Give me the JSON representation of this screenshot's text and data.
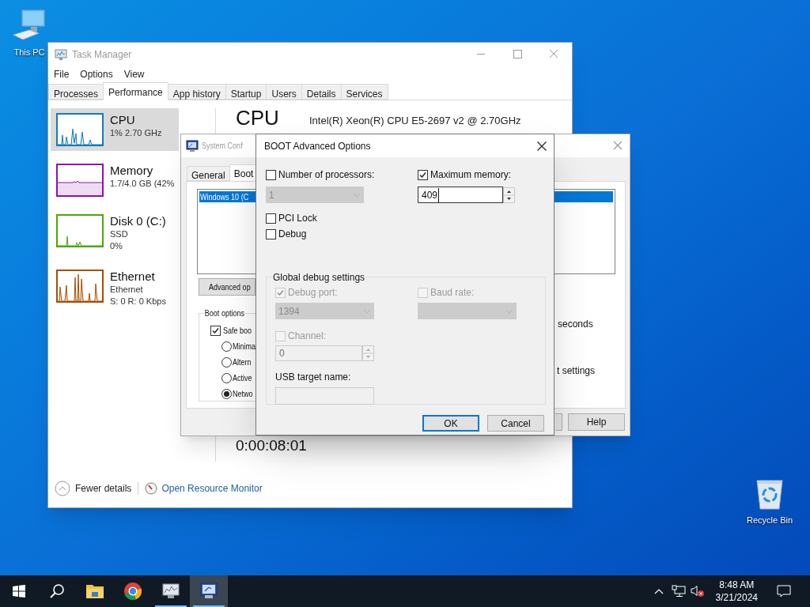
{
  "desktop_icons": [
    {
      "kind": "computer",
      "label": "This PC"
    },
    {
      "kind": "recycle",
      "label": "Recycle Bin"
    }
  ],
  "task_manager": {
    "title": "Task Manager",
    "menu": [
      "File",
      "Options",
      "View"
    ],
    "tabs": [
      {
        "label": "Processes",
        "selected": false
      },
      {
        "label": "Performance",
        "selected": true
      },
      {
        "label": "App history",
        "selected": false
      },
      {
        "label": "Startup",
        "selected": false
      },
      {
        "label": "Users",
        "selected": false
      },
      {
        "label": "Details",
        "selected": false
      },
      {
        "label": "Services",
        "selected": false
      }
    ],
    "resources": [
      {
        "kind": "cpu",
        "name": "CPU",
        "lines": [
          "1% 2.70 GHz"
        ],
        "color": "#117dbb",
        "selected": true
      },
      {
        "kind": "memory",
        "name": "Memory",
        "lines": [
          "1.7/4.0 GB (42%"
        ],
        "color": "#8b12ae",
        "selected": false
      },
      {
        "kind": "disk",
        "name": "Disk 0 (C:)",
        "lines": [
          "SSD",
          "0%"
        ],
        "color": "#4da60c",
        "selected": false
      },
      {
        "kind": "ethernet",
        "name": "Ethernet",
        "lines": [
          "Ethernet",
          "S: 0 R: 0 Kbps"
        ],
        "color": "#a74f01",
        "selected": false
      }
    ],
    "heading": "CPU",
    "processor": "Intel(R) Xeon(R) CPU E5-2697 v2 @ 2.70GHz",
    "uptime": "0:00:08:01",
    "fewer_details": "Fewer details",
    "resource_monitor_link": "Open Resource Monitor"
  },
  "system_configuration": {
    "title": "System Conf",
    "tabs": [
      {
        "label": "General",
        "selected": false
      },
      {
        "label": "Boot",
        "selected": true
      }
    ],
    "boot_entries": [
      {
        "label": "Windows 10 (C",
        "selected": true
      }
    ],
    "advanced_button": "Advanced op",
    "boot_options": {
      "title": "Boot options",
      "safe_boot": {
        "label": "Safe boo",
        "checked": true
      },
      "modes": [
        {
          "label": "Minima",
          "selected": false
        },
        {
          "label": "Altern",
          "selected": false
        },
        {
          "label": "Active",
          "selected": false
        },
        {
          "label": "Netwo",
          "selected": true
        }
      ]
    },
    "timeout_unit": "seconds",
    "settings_fragment": "t settings",
    "help_button": "Help"
  },
  "boot_advanced_options": {
    "title": "BOOT Advanced Options",
    "number_of_processors": {
      "label": "Number of processors:",
      "checked": false,
      "value": "1",
      "disabled": true
    },
    "maximum_memory": {
      "label": "Maximum memory:",
      "checked": true,
      "value": "409",
      "disabled": false
    },
    "pci_lock": {
      "label": "PCI Lock",
      "checked": false
    },
    "debug": {
      "label": "Debug",
      "checked": false
    },
    "global_debug_settings": {
      "title": "Global debug settings",
      "debug_port": {
        "label": "Debug port:",
        "checked": true,
        "disabled": true,
        "value": "1394"
      },
      "baud_rate": {
        "label": "Baud rate:",
        "checked": false,
        "disabled": true
      },
      "channel": {
        "label": "Channel:",
        "checked": false,
        "disabled": true,
        "value": "0"
      },
      "usb_target_name": {
        "label": "USB target name:",
        "disabled": true
      }
    },
    "buttons": [
      {
        "label": "OK",
        "default": true
      },
      {
        "label": "Cancel",
        "default": false
      }
    ]
  },
  "taskbar": {
    "apps": [
      {
        "kind": "explorer",
        "running": false,
        "selected": false
      },
      {
        "kind": "browser",
        "running": false,
        "selected": false
      },
      {
        "kind": "task-manager",
        "running": true,
        "selected": false
      },
      {
        "kind": "system-config",
        "running": true,
        "selected": true
      }
    ],
    "time": "8:48 AM",
    "date": "3/21/2024"
  }
}
